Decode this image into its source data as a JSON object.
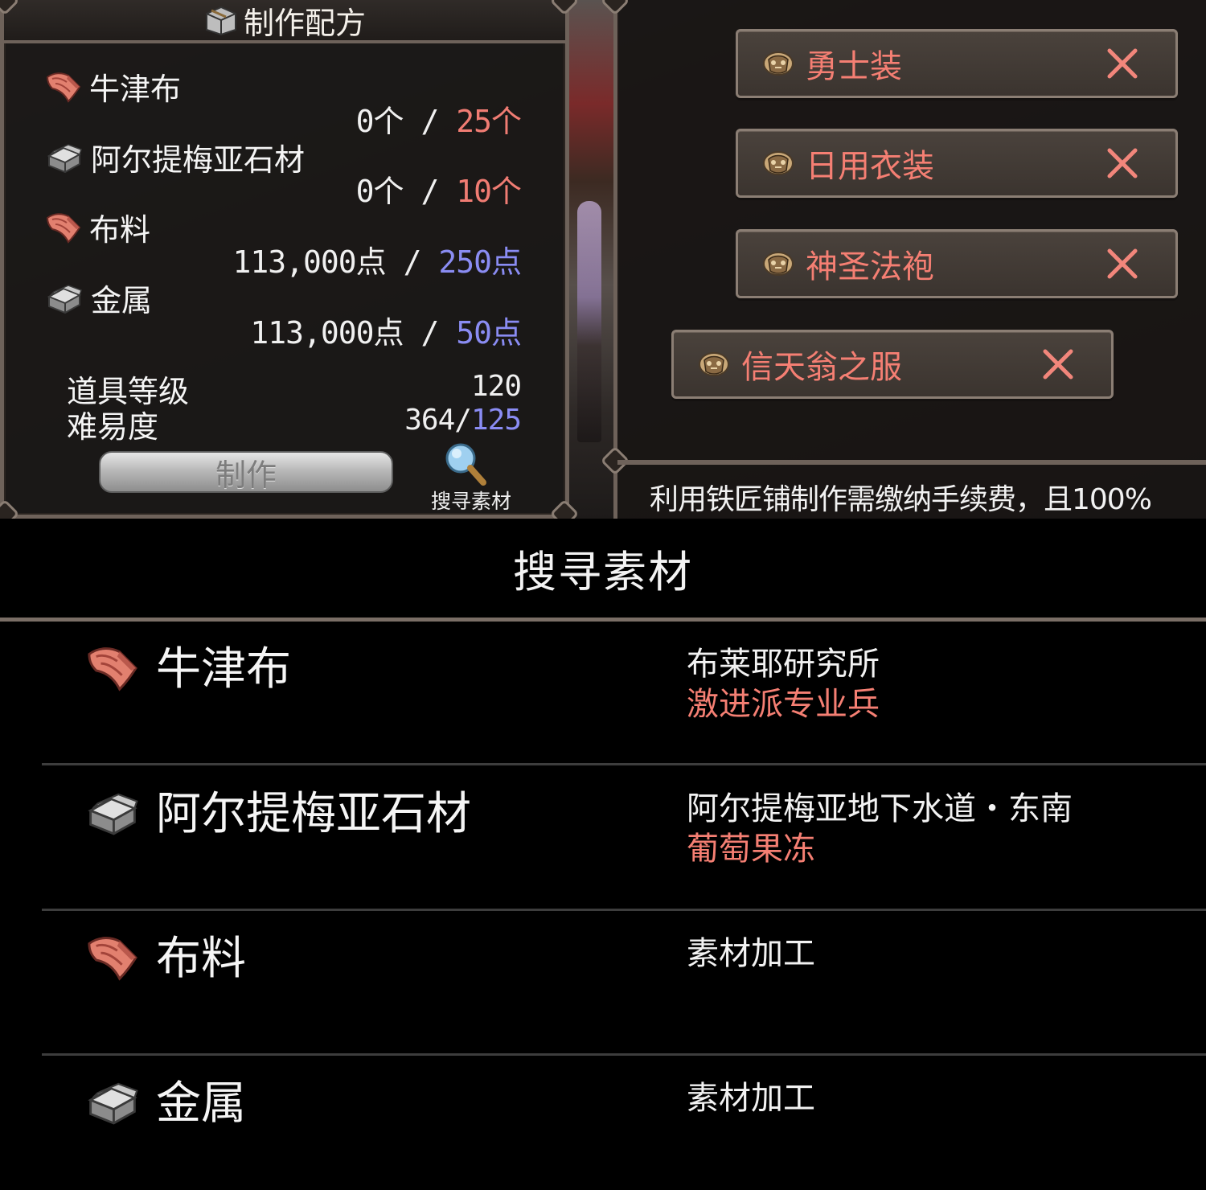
{
  "recipe": {
    "title": "制作配方",
    "materials": [
      {
        "name": "牛津布",
        "icon": "cloth-icon",
        "have": "0个",
        "sep": "/",
        "need": "25个",
        "need_color": "red"
      },
      {
        "name": "阿尔提梅亚石材",
        "icon": "stone-icon",
        "have": "0个",
        "sep": "/",
        "need": "10个",
        "need_color": "red"
      },
      {
        "name": "布料",
        "icon": "cloth-icon",
        "have": "113,000点",
        "sep": "/",
        "need": "250点",
        "need_color": "blue"
      },
      {
        "name": "金属",
        "icon": "stone-icon",
        "have": "113,000点",
        "sep": "/",
        "need": "50点",
        "need_color": "blue"
      }
    ],
    "item_level_label": "道具等级",
    "item_level_value": "120",
    "difficulty_label": "难易度",
    "difficulty_current": "364",
    "difficulty_sep": "/",
    "difficulty_max": "125",
    "craft_button": "制作",
    "search_materials_button": "搜寻素材"
  },
  "categories": [
    {
      "label": "勇士装"
    },
    {
      "label": "日用衣装"
    },
    {
      "label": "神圣法袍"
    },
    {
      "label": "信天翁之服"
    }
  ],
  "info_text": "利用铁匠铺制作需缴纳手续费，且100%",
  "search_sheet": {
    "title": "搜寻素材",
    "rows": [
      {
        "name": "牛津布",
        "icon": "cloth-icon",
        "location": "布莱耶研究所",
        "monster": "激进派专业兵"
      },
      {
        "name": "阿尔提梅亚石材",
        "icon": "stone-icon",
        "location": "阿尔提梅亚地下水道・东南",
        "monster": "葡萄果冻"
      },
      {
        "name": "布料",
        "icon": "cloth-icon",
        "location": "素材加工",
        "monster": ""
      },
      {
        "name": "金属",
        "icon": "stone-icon",
        "location": "素材加工",
        "monster": ""
      }
    ]
  },
  "colors": {
    "accent_red": "#f07c73",
    "accent_blue": "#8a8cf3",
    "panel_border": "#6e625a"
  }
}
